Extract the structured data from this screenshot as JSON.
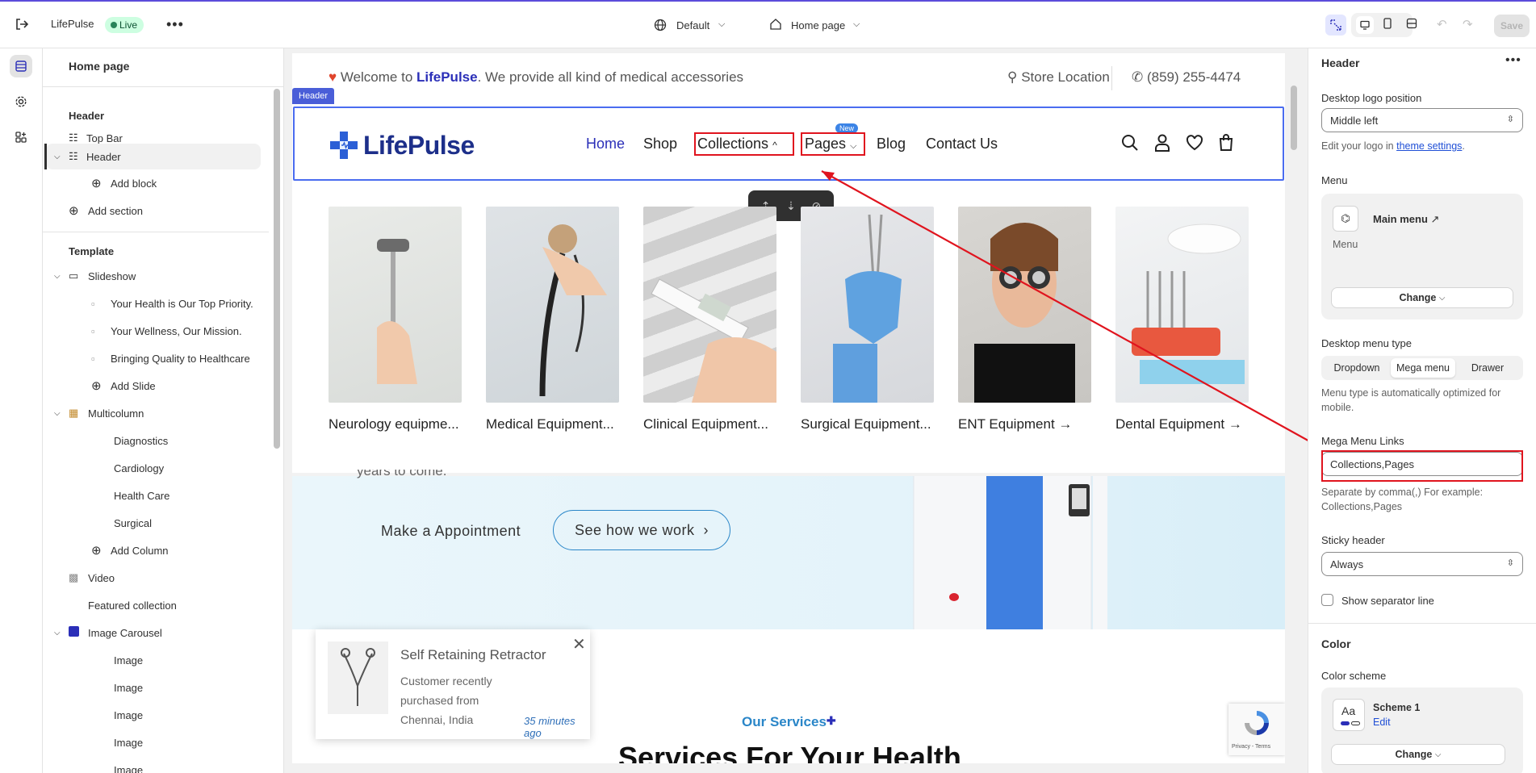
{
  "topbar": {
    "store_name": "LifePulse",
    "live_badge": "Live",
    "theme_selector": "Default",
    "page_selector": "Home page",
    "save_label": "Save"
  },
  "tree": {
    "title": "Home page",
    "header_group": "Header",
    "items": {
      "top_bar": "Top Bar",
      "header": "Header",
      "add_block": "Add block",
      "add_section_1": "Add section",
      "template": "Template",
      "slideshow": "Slideshow",
      "slide1": "Your Health is Our Top Priority.",
      "slide2": "Your Wellness, Our Mission.",
      "slide3": "Bringing Quality to Healthcare",
      "add_slide": "Add Slide",
      "multicolumn": "Multicolumn",
      "col1": "Diagnostics",
      "col2": "Cardiology",
      "col3": "Health Care",
      "col4": "Surgical",
      "add_column": "Add Column",
      "video": "Video",
      "featured": "Featured collection",
      "image_carousel": "Image Carousel",
      "image": "Image"
    }
  },
  "preview": {
    "announcement_prefix": "Welcome to ",
    "announcement_brand": "LifePulse",
    "announcement_suffix": ". We provide all kind of medical accessories",
    "store_location": "Store Location",
    "phone": "(859) 255-4474",
    "header_tag": "Header",
    "logo_text": "LifePulse",
    "nav": {
      "home": "Home",
      "shop": "Shop",
      "collections": "Collections",
      "pages": "Pages",
      "new_badge": "New",
      "blog": "Blog",
      "contact": "Contact Us"
    },
    "mega_cards": [
      "Neurology equipme...",
      "Medical Equipment...",
      "Clinical Equipment...",
      "Surgical Equipment...",
      "ENT Equipment →",
      "Dental Equipment →"
    ],
    "hero_text": "years to come.",
    "appointment_btn": "Make a Appointment",
    "see_btn": "See how we work",
    "popup": {
      "product": "Self Retaining Retractor",
      "line1": "Customer recently",
      "line2": "purchased from",
      "line3": "Chennai, India",
      "time": "35 minutes ago"
    },
    "services_kicker": "Our Services",
    "services_title": "Services For Your Health",
    "recaptcha": "Privacy - Terms"
  },
  "settings": {
    "title": "Header",
    "logo_position_label": "Desktop logo position",
    "logo_position_value": "Middle left",
    "logo_help_prefix": "Edit your logo in ",
    "logo_help_link": "theme settings",
    "logo_help_suffix": ".",
    "menu_label": "Menu",
    "menu_name": "Main menu",
    "menu_sub": "Menu",
    "change_label": "Change",
    "menu_type_label": "Desktop menu type",
    "menu_type_options": [
      "Dropdown",
      "Mega menu",
      "Drawer"
    ],
    "menu_type_help": "Menu type is automatically optimized for mobile.",
    "mega_links_label": "Mega Menu Links",
    "mega_links_value": "Collections,Pages",
    "mega_links_help": "Separate by comma(,) For example: Collections,Pages",
    "sticky_label": "Sticky header",
    "sticky_value": "Always",
    "separator_label": "Show separator line",
    "color_heading": "Color",
    "color_scheme_label": "Color scheme",
    "scheme_name": "Scheme 1",
    "scheme_edit": "Edit",
    "scheme_sample": "Aa",
    "change_label2": "Change"
  },
  "colors": {
    "accent": "#1f4fd6",
    "annotation_red": "#e0141e",
    "brand_blue": "#2b2fb8",
    "live_green": "#29845a"
  }
}
